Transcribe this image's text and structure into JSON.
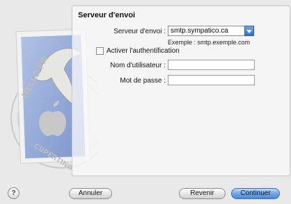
{
  "section": {
    "title": "Serveur d'envoi"
  },
  "smtp": {
    "label": "Serveur d'envoi :",
    "value": "smtp.sympatico.ca",
    "hint": "Exemple : smtp.exemple.com"
  },
  "auth": {
    "checkbox_label": "Activer l'authentification",
    "checked": false
  },
  "username": {
    "label": "Nom d'utilisateur :",
    "value": ""
  },
  "password": {
    "label": "Mot de passe :",
    "value": ""
  },
  "buttons": {
    "help": "?",
    "cancel": "Annuler",
    "back": "Revenir",
    "continue": "Continuer"
  },
  "stamp": {
    "text_top": "HELLO FR",
    "text_bottom": "CUPERTINO"
  },
  "colors": {
    "accent": "#4a8ad9",
    "stamp_blue": "#8fa7d6"
  }
}
